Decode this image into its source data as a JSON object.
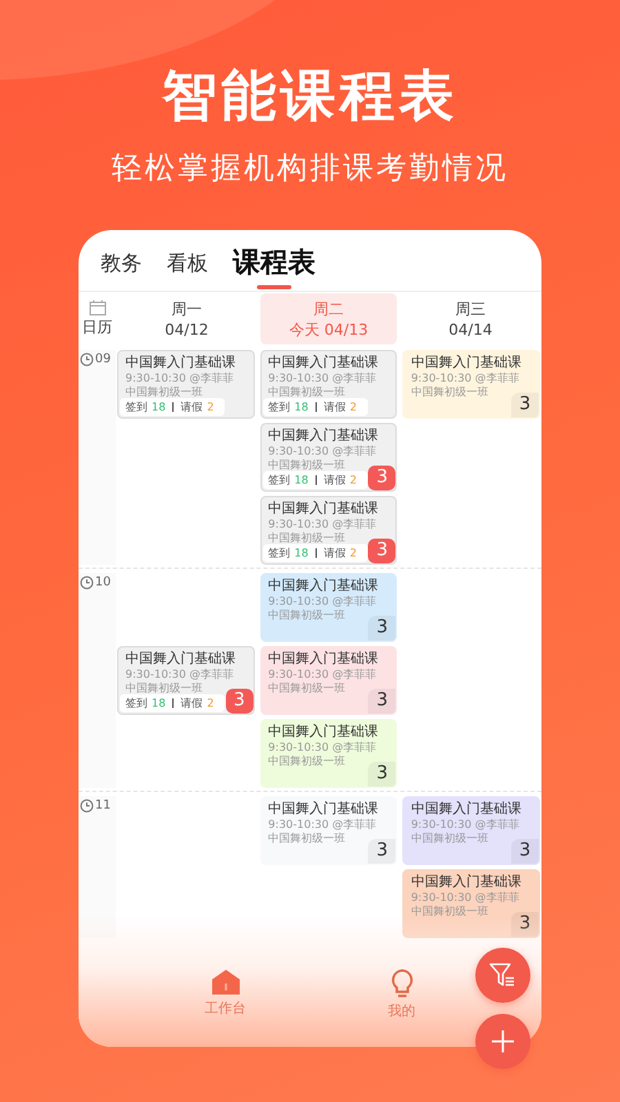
{
  "hero": {
    "title": "智能课程表",
    "subtitle": "轻松掌握机构排课考勤情况"
  },
  "tabs": [
    {
      "label": "教务",
      "selected": false
    },
    {
      "label": "看板",
      "selected": false
    },
    {
      "label": "课程表",
      "selected": true
    }
  ],
  "calendar_label": "日历",
  "days": [
    {
      "weekday": "周一",
      "date": "04/12",
      "selected": false
    },
    {
      "weekday": "周二",
      "date": "今天 04/13",
      "selected": true
    },
    {
      "weekday": "周三",
      "date": "04/14",
      "selected": false
    }
  ],
  "hours": [
    {
      "label": "09",
      "rows": [
        {
          "mon": {
            "title": "中国舞入门基础课",
            "time": "9:30-10:30 @李菲菲",
            "class": "中国舞初级一班",
            "color": "#f0f0f0",
            "attendance": {
              "signin_label": "签到",
              "signin": "18",
              "leave_label": "请假",
              "leave": "2"
            }
          },
          "tue": {
            "title": "中国舞入门基础课",
            "time": "9:30-10:30 @李菲菲",
            "class": "中国舞初级一班",
            "color": "#f0f0f0",
            "attendance": {
              "signin_label": "签到",
              "signin": "18",
              "leave_label": "请假",
              "leave": "2"
            }
          },
          "wed": {
            "title": "中国舞入门基础课",
            "time": "9:30-10:30 @李菲菲",
            "class": "中国舞初级一班",
            "color": "#fff5df",
            "count": "3",
            "alert": false
          }
        },
        {
          "tue": {
            "title": "中国舞入门基础课",
            "time": "9:30-10:30 @李菲菲",
            "class": "中国舞初级一班",
            "color": "#f0f0f0",
            "attendance": {
              "signin_label": "签到",
              "signin": "18",
              "leave_label": "请假",
              "leave": "2"
            },
            "count": "3",
            "alert": true
          }
        },
        {
          "tue": {
            "title": "中国舞入门基础课",
            "time": "9:30-10:30 @李菲菲",
            "class": "中国舞初级一班",
            "color": "#f0f0f0",
            "attendance": {
              "signin_label": "签到",
              "signin": "18",
              "leave_label": "请假",
              "leave": "2"
            },
            "count": "3",
            "alert": true
          }
        }
      ]
    },
    {
      "label": "10",
      "rows": [
        {
          "tue": {
            "title": "中国舞入门基础课",
            "time": "9:30-10:30 @李菲菲",
            "class": "中国舞初级一班",
            "color": "#d5ebfc",
            "count": "3",
            "alert": false
          }
        },
        {
          "mon": {
            "title": "中国舞入门基础课",
            "time": "9:30-10:30 @李菲菲",
            "class": "中国舞初级一班",
            "color": "#f0f0f0",
            "attendance": {
              "signin_label": "签到",
              "signin": "18",
              "leave_label": "请假",
              "leave": "2"
            },
            "count": "3",
            "alert": true
          },
          "tue": {
            "title": "中国舞入门基础课",
            "time": "9:30-10:30 @李菲菲",
            "class": "中国舞初级一班",
            "color": "#fde2e4",
            "count": "3",
            "alert": false
          }
        },
        {
          "tue": {
            "title": "中国舞入门基础课",
            "time": "9:30-10:30 @李菲菲",
            "class": "中国舞初级一班",
            "color": "#effcdc",
            "count": "3",
            "alert": false
          }
        }
      ]
    },
    {
      "label": "11",
      "rows": [
        {
          "tue": {
            "title": "中国舞入门基础课",
            "time": "9:30-10:30 @李菲菲",
            "class": "中国舞初级一班",
            "color": "#f8f9fb",
            "count": "3",
            "alert": false
          },
          "wed": {
            "title": "中国舞入门基础课",
            "time": "9:30-10:30 @李菲菲",
            "class": "中国舞初级一班",
            "color": "#e4e1fb",
            "count": "3",
            "alert": false
          }
        },
        {
          "wed": {
            "title": "中国舞入门基础课",
            "time": "9:30-10:30 @李菲菲",
            "class": "中国舞初级一班",
            "color": "#fcd3bd",
            "count": "3",
            "alert": false
          }
        }
      ]
    }
  ],
  "nav": [
    {
      "label": "工作台",
      "kind": "home"
    },
    {
      "label": "我的",
      "kind": "bulb"
    }
  ]
}
